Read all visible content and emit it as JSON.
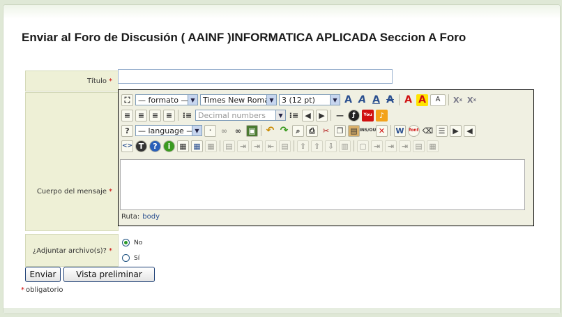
{
  "page": {
    "title": "Enviar al Foro de Discusión ( AAINF )INFORMATICA APLICADA Seccion A Foro"
  },
  "form": {
    "title_label": "Título",
    "body_label": "Cuerpo del mensaje",
    "attach_label": "¿Adjuntar archivo(s)?",
    "required_mark": "*",
    "attach_options": [
      "No",
      "Sí"
    ],
    "attach_selected": "No",
    "title_value": ""
  },
  "editor": {
    "format_select": "— formato —",
    "font_select": "Times New Roman",
    "size_select": "3 (12 pt)",
    "list_select": "Decimal numbers",
    "language_select": "— language —",
    "path_label": "Ruta:",
    "path_value": "body",
    "icons_row1": [
      "fullscreen-icon",
      "bold-icon",
      "italic-icon",
      "underline-icon",
      "strikethrough-icon",
      "text-color-icon",
      "highlight-color-icon",
      "text-box-icon",
      "subscript-icon",
      "superscript-icon"
    ],
    "icons_row2": [
      "align-left-icon",
      "align-center-icon",
      "align-right-icon",
      "justify-icon",
      "numbered-list-icon",
      "bullet-list-icon",
      "outdent-icon",
      "indent-icon",
      "horizontal-rule-icon",
      "flash-icon",
      "youtube-icon",
      "media-icon"
    ],
    "icons_row3": [
      "help-icon",
      "nonbreaking-space-icon",
      "link-icon",
      "unlink-icon",
      "image-icon",
      "undo-icon",
      "redo-icon",
      "find-replace-icon",
      "print-icon",
      "cut-icon",
      "copy-icon",
      "paste-icon",
      "insert-del-icon",
      "cleanup-icon",
      "paste-word-icon",
      "remove-font-icon",
      "eraser-icon",
      "page-break-icon",
      "ltr-icon",
      "rtl-icon"
    ],
    "icons_row4": [
      "source-code-icon",
      "spellcheck-icon",
      "help-circle-icon",
      "info-icon",
      "table-icon",
      "table-props-icon",
      "table-disabled-icon"
    ]
  },
  "buttons": {
    "submit": "Enviar",
    "preview": "Vista preliminar"
  },
  "note": {
    "mark": "*",
    "text": "obligatorio"
  },
  "colors": {
    "label_bg": "#eef0d6",
    "accent_blue": "#2a4f8f",
    "required": "#cc0000"
  }
}
